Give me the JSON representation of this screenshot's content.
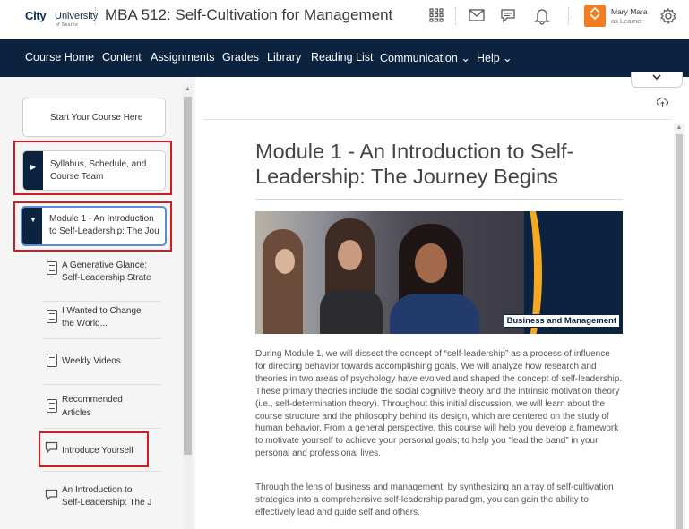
{
  "header": {
    "logo_city": "City",
    "logo_univ": "University",
    "logo_sub": "of Seattle",
    "course_title": "MBA 512: Self-Cultivation for Management",
    "user_name": "Mary Mara",
    "user_role": "as Learner"
  },
  "nav": {
    "items": [
      "Course Home",
      "Content",
      "Assignments",
      "Grades",
      "Library",
      "Reading List",
      "Communication ⌄",
      "Help ⌄"
    ]
  },
  "toc": {
    "start_label": "Start Your Course Here",
    "syllabus_line1": "Syllabus, Schedule, and",
    "syllabus_line2": "Course Team",
    "module1_line1": "Module 1 - An Introduction",
    "module1_line2": "to Self-Leadership: The Jou",
    "subitems": [
      {
        "line1": "A Generative Glance:",
        "line2": "Self-Leadership Strate"
      },
      {
        "line1": "I Wanted to Change",
        "line2": "the World..."
      },
      {
        "line1": "Weekly Videos",
        "line2": ""
      },
      {
        "line1": "Recommended",
        "line2": "Articles"
      },
      {
        "line1": "Introduce Yourself",
        "line2": ""
      },
      {
        "line1": "An Introduction to",
        "line2": "Self-Leadership: The J"
      }
    ]
  },
  "content": {
    "title_line1": "Module 1 - An Introduction to Self-",
    "title_line2": "Leadership: The Journey Begins",
    "banner_tag": "Business and Management",
    "para1": "During Module 1, we will dissect the concept of “self-leadership” as a process of influence for directing behavior towards accomplishing goals. We will analyze how research and theories in two areas of psychology have evolved and shaped the concept of self-leadership. These primary theories include the social cognitive theory and the intrinsic motivation theory (i.e., self-determination theory). Throughout this initial discussion, we will learn about the course structure and the philosophy behind its design, which are centered on the study of human behavior. From a general perspective, this course will help you develop a framework to motivate yourself to achieve your personal goals; to help you “lead the band” in your personal and professional lives.",
    "para2": "Through the lens of business and management, by synthesizing an array of self-cultivation strategies into a comprehensive self-leadership paradigm, you can gain the ability to effectively lead and guide self and others."
  },
  "icons": [
    "apps-grid-icon",
    "mail-icon",
    "chat-icon",
    "bell-icon",
    "gear-icon",
    "cloud-sync-icon",
    "chevron-down-icon"
  ],
  "colors": {
    "nav_bg": "#0c2340",
    "highlight": "#d71920",
    "accent": "#f6a821"
  }
}
